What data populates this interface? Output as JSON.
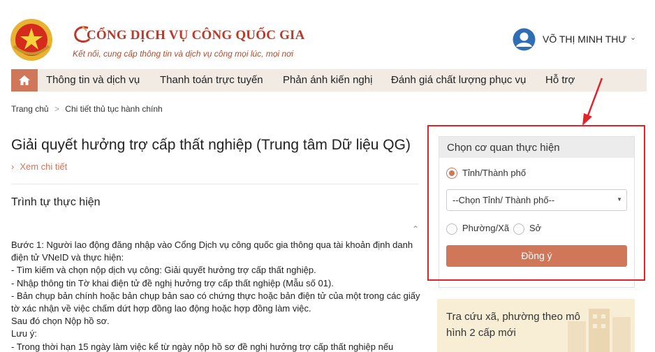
{
  "header": {
    "brand_title": "CỔNG DỊCH VỤ CÔNG QUỐC GIA",
    "brand_subtitle": "Kết nối, cung cấp thông tin và dịch vụ công mọi lúc, mọi nơi",
    "user_name": "VÕ THỊ MINH THƯ"
  },
  "nav": {
    "items": [
      "Thông tin và dịch vụ",
      "Thanh toán trực tuyến",
      "Phản ánh kiến nghị",
      "Đánh giá chất lượng phục vụ",
      "Hỗ trợ"
    ]
  },
  "breadcrumb": {
    "home": "Trang chủ",
    "sep": ">",
    "current": "Chi tiết thủ tục hành chính"
  },
  "main": {
    "title": "Giải quyết hưởng trợ cấp thất nghiệp (Trung tâm Dữ liệu QG)",
    "see_more": "Xem chi tiết",
    "section_title": "Trình tự thực hiện",
    "body_lines": [
      "Bước 1: Người lao động đăng nhập vào Cổng Dịch vụ công quốc gia thông qua tài khoản định danh điện tử VNeID và thực hiện:",
      "- Tìm kiếm và chọn nộp dịch vụ công: Giải quyết hưởng trợ cấp thất nghiệp.",
      "- Nhập thông tin Tờ khai điện tử đề nghị hưởng trợ cấp thất nghiệp (Mẫu số 01).",
      "- Bản chụp bản chính hoặc bản chụp bản sao có chứng thực hoặc bản điện tử của một trong các giấy tờ xác nhận về việc chấm dứt hợp đồng lao động hoặc hợp đồng làm việc.",
      "Sau đó chọn Nộp hồ sơ.",
      "Lưu ý:",
      "- Trong thời hạn 15 ngày làm việc kể từ ngày nộp hồ sơ đề nghị hưởng trợ cấp thất nghiệp nếu"
    ]
  },
  "panel": {
    "header": "Chọn cơ quan thực hiện",
    "radio_province": "Tỉnh/Thành phố",
    "select_placeholder": "--Chọn Tỉnh/ Thành phố--",
    "radio_ward": "Phường/Xã",
    "radio_department": "Sở",
    "agree_button": "Đồng ý"
  },
  "promo": {
    "text": "Tra cứu xã, phường theo mô hình 2 cấp mới"
  },
  "colors": {
    "accent": "#d0775a",
    "brand_red": "#b93a2a",
    "nav_bg": "#f1ebe3",
    "annotation_red": "#e2242a",
    "promo_bg": "#f8eed5"
  }
}
